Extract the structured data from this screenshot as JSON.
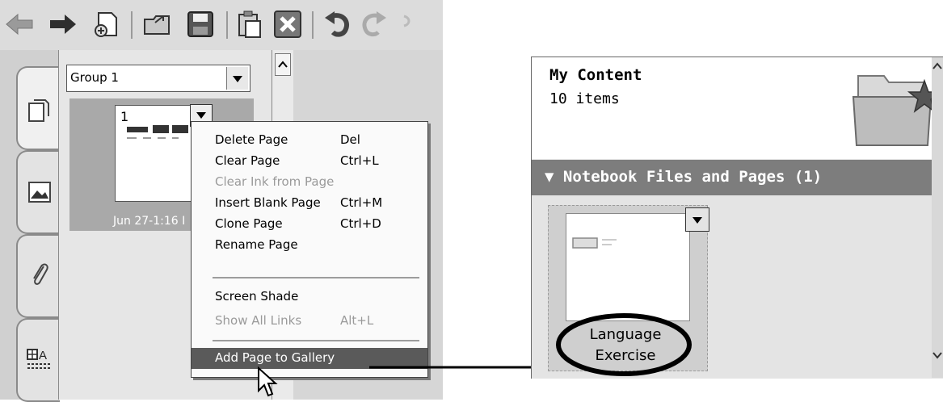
{
  "toolbar": {
    "icons": [
      "back-arrow-icon",
      "forward-arrow-icon",
      "new-page-icon",
      "open-file-icon",
      "save-icon",
      "paste-icon",
      "delete-icon",
      "undo-icon",
      "redo-icon"
    ]
  },
  "side_tabs": [
    "page-sorter-icon",
    "gallery-icon",
    "attachments-icon",
    "properties-icon"
  ],
  "group_select": {
    "value": "Group 1"
  },
  "thumbnail": {
    "page_number": "1",
    "date_label": "Jun 27-1:16 I"
  },
  "context_menu": {
    "items": [
      {
        "label": "Delete Page",
        "shortcut": "Del"
      },
      {
        "label": "Clear Page",
        "shortcut": "Ctrl+L"
      },
      {
        "label": "Clear Ink from Page",
        "shortcut": ""
      },
      {
        "label": "Insert Blank Page",
        "shortcut": "Ctrl+M"
      },
      {
        "label": "Clone Page",
        "shortcut": "Ctrl+D"
      },
      {
        "label": "Rename Page",
        "shortcut": ""
      },
      {
        "label": "Screen Shade",
        "shortcut": ""
      },
      {
        "label": "Show All Links",
        "shortcut": "Alt+L"
      },
      {
        "label": "Add Page to Gallery",
        "shortcut": ""
      }
    ]
  },
  "gallery": {
    "title": "My Content",
    "count": "10 items",
    "section": "▼ Notebook Files and Pages (1)",
    "item": {
      "label_line1": "Language",
      "label_line2": "Exercise"
    }
  },
  "colors": {
    "menu_highlight": "#5a5a5a",
    "section_bar": "#7d7d7d"
  }
}
